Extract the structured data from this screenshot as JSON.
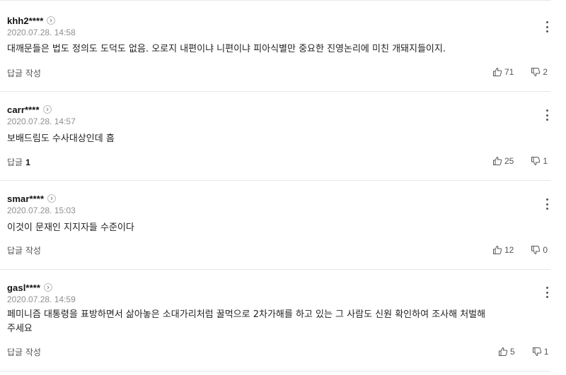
{
  "comments": [
    {
      "username": "khh2****",
      "date": "2020.07.28. 14:58",
      "text": "대깨문들은 법도 정의도 도덕도 없음. 오로지 내편이냐 니편이냐 피아식별만 중요한 진영논리에 미친 개돼지들이지.",
      "reply_label": "답글 작성",
      "reply_count": "",
      "likes": "71",
      "dislikes": "2"
    },
    {
      "username": "carr****",
      "date": "2020.07.28. 14:57",
      "text": "보배드림도 수사대상인데 흠",
      "reply_label": "답글",
      "reply_count": "1",
      "likes": "25",
      "dislikes": "1"
    },
    {
      "username": "smar****",
      "date": "2020.07.28. 15:03",
      "text": "이것이 문재인 지지자들 수준이다",
      "reply_label": "답글 작성",
      "reply_count": "",
      "likes": "12",
      "dislikes": "0"
    },
    {
      "username": "gasl****",
      "date": "2020.07.28. 14:59",
      "text": "페미니즘 대통령을 표방하면서 삶아놓은 소대가리처럼 꿀먹으로 2차가해를 하고 있는 그 사람도 신원 확인하여 조사해 처벌해\n주세요",
      "reply_label": "답글 작성",
      "reply_count": "",
      "likes": "5",
      "dislikes": "1"
    }
  ],
  "icons": {
    "profile_arrow": "chevron-right-icon",
    "like": "thumbs-up-icon",
    "dislike": "thumbs-down-icon",
    "more": "more-vertical-icon"
  }
}
